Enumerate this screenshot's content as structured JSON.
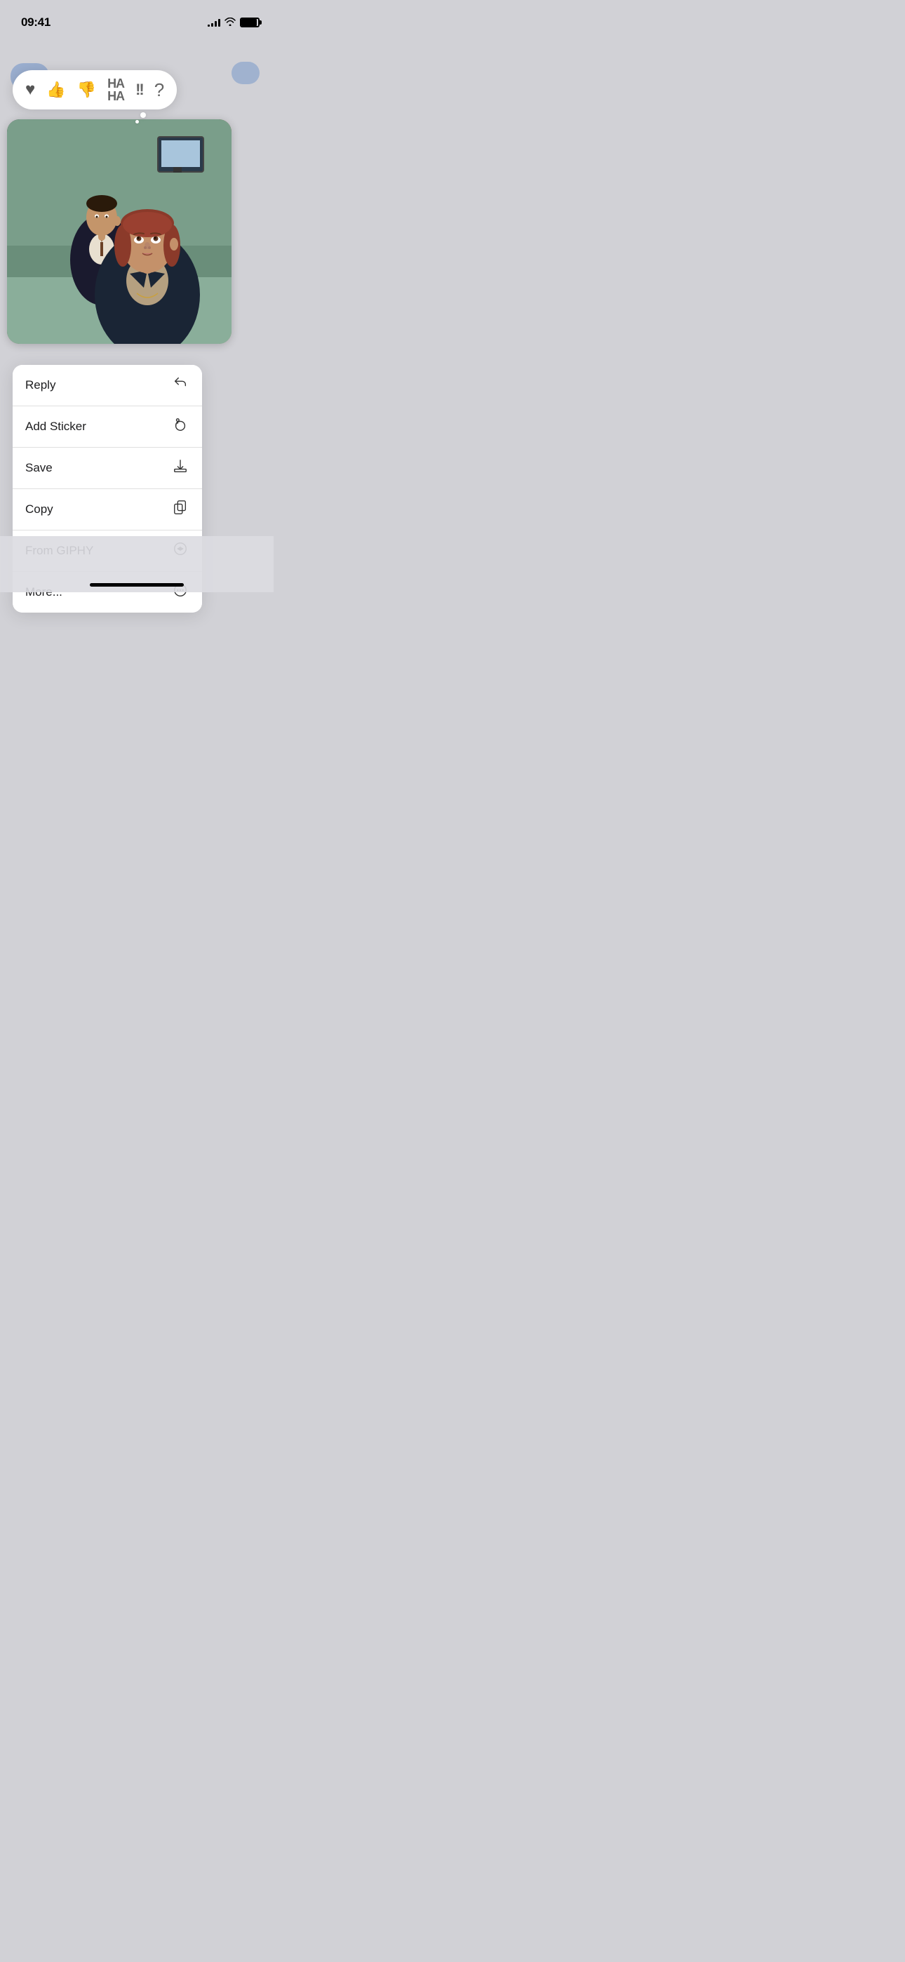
{
  "statusBar": {
    "time": "09:41",
    "signalBars": [
      3,
      5,
      7,
      10,
      12
    ],
    "battery": 100
  },
  "reactionBar": {
    "reactions": [
      {
        "id": "heart",
        "symbol": "♥",
        "type": "heart",
        "label": "Heart"
      },
      {
        "id": "thumbsup",
        "symbol": "👍",
        "type": "thumbsup",
        "label": "Like"
      },
      {
        "id": "thumbsdown",
        "symbol": "👎",
        "type": "thumbsdown",
        "label": "Dislike"
      },
      {
        "id": "haha",
        "symbol": "HA HA",
        "type": "haha",
        "label": "Haha"
      },
      {
        "id": "exclaim",
        "symbol": "!!",
        "type": "exclaim",
        "label": "Emphasize"
      },
      {
        "id": "question",
        "symbol": "?",
        "type": "question",
        "label": "Question"
      }
    ]
  },
  "contextMenu": {
    "items": [
      {
        "id": "reply",
        "label": "Reply",
        "iconType": "reply"
      },
      {
        "id": "add-sticker",
        "label": "Add Sticker",
        "iconType": "sticker"
      },
      {
        "id": "save",
        "label": "Save",
        "iconType": "save"
      },
      {
        "id": "copy",
        "label": "Copy",
        "iconType": "copy"
      },
      {
        "id": "from-giphy",
        "label": "From GIPHY",
        "iconType": "appstore"
      },
      {
        "id": "more",
        "label": "More...",
        "iconType": "more"
      }
    ]
  }
}
